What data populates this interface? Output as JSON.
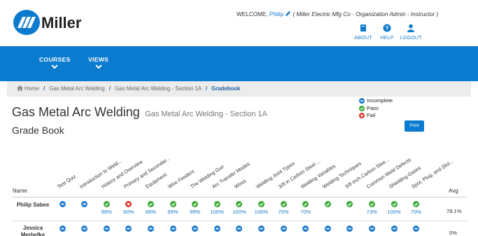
{
  "brand": {
    "logo_text": "Miller",
    "accent": "#0a7bce",
    "link": "#1a7bc4"
  },
  "header": {
    "welcome_prefix": "WELCOME,",
    "user": "Philip",
    "org_text": "( Miller Electric Mfg Co - Organization Admin - Instructor )"
  },
  "top_links": [
    {
      "label": "ABOUT",
      "icon": "book-icon"
    },
    {
      "label": "HELP",
      "icon": "question-icon"
    },
    {
      "label": "LOGOUT",
      "icon": "user-icon"
    }
  ],
  "nav": [
    {
      "label": "COURSES",
      "icon": "chevron-down-icon"
    },
    {
      "label": "VIEWS",
      "icon": "chevron-down-icon"
    }
  ],
  "breadcrumbs": [
    "Home",
    "Gas Metal Arc Welding",
    "Gas Metal Arc Welding - Section 1A",
    "Gradebook"
  ],
  "page": {
    "title": "Gas Metal Arc Welding",
    "subtitle": "Gas Metal Arc Welding - Section 1A",
    "heading": "Grade Book",
    "print_label": "Print"
  },
  "legend": [
    {
      "status": "incomplete",
      "label": "Incomplete",
      "color": "#1f7bd0"
    },
    {
      "status": "pass",
      "label": "Pass",
      "color": "#3aaa35"
    },
    {
      "status": "fail",
      "label": "Fail",
      "color": "#e0322a"
    }
  ],
  "table": {
    "name_header": "Name",
    "avg_header": "Avg",
    "columns": [
      "Test Quiz",
      "Introduction to Weld...",
      "History and Overview",
      "Primary and Secondar...",
      "Equipment",
      "Wire Feeders",
      "The Welding Gun",
      "Arc Transfer Modes",
      "Wires",
      "Welding Joint Types",
      "3/8 in Carbon Steel ...",
      "Welding Variables",
      "Welding Techniques",
      "3/8 inch Carbon Stee...",
      "Common Weld Defects",
      "Shielding Gases",
      "Spot, Plug, and Slot..."
    ],
    "rows": [
      {
        "name": "Philip Sabee",
        "avg": "78.1%",
        "cells": [
          {
            "status": "incomplete",
            "score": ""
          },
          {
            "status": "incomplete",
            "score": ""
          },
          {
            "status": "pass",
            "score": "99%"
          },
          {
            "status": "fail",
            "score": "60%"
          },
          {
            "status": "pass",
            "score": "88%"
          },
          {
            "status": "pass",
            "score": "99%"
          },
          {
            "status": "pass",
            "score": "99%"
          },
          {
            "status": "pass",
            "score": "100%"
          },
          {
            "status": "pass",
            "score": "100%"
          },
          {
            "status": "pass",
            "score": "100%"
          },
          {
            "status": "pass",
            "score": "70%"
          },
          {
            "status": "pass",
            "score": "70%"
          },
          {
            "status": "pass",
            "score": ""
          },
          {
            "status": "pass",
            "score": ""
          },
          {
            "status": "pass",
            "score": "73%"
          },
          {
            "status": "pass",
            "score": "100%"
          },
          {
            "status": "pass",
            "score": "70%"
          }
        ]
      },
      {
        "name": "Jessica Merhefke",
        "avg": "0%",
        "cells": [
          {
            "status": "incomplete",
            "score": ""
          },
          {
            "status": "incomplete",
            "score": ""
          },
          {
            "status": "incomplete",
            "score": ""
          },
          {
            "status": "incomplete",
            "score": ""
          },
          {
            "status": "incomplete",
            "score": ""
          },
          {
            "status": "incomplete",
            "score": ""
          },
          {
            "status": "incomplete",
            "score": ""
          },
          {
            "status": "incomplete",
            "score": ""
          },
          {
            "status": "incomplete",
            "score": ""
          },
          {
            "status": "incomplete",
            "score": ""
          },
          {
            "status": "incomplete",
            "score": ""
          },
          {
            "status": "incomplete",
            "score": ""
          },
          {
            "status": "incomplete",
            "score": ""
          },
          {
            "status": "incomplete",
            "score": ""
          },
          {
            "status": "incomplete",
            "score": ""
          },
          {
            "status": "incomplete",
            "score": ""
          },
          {
            "status": "incomplete",
            "score": ""
          }
        ]
      }
    ]
  }
}
